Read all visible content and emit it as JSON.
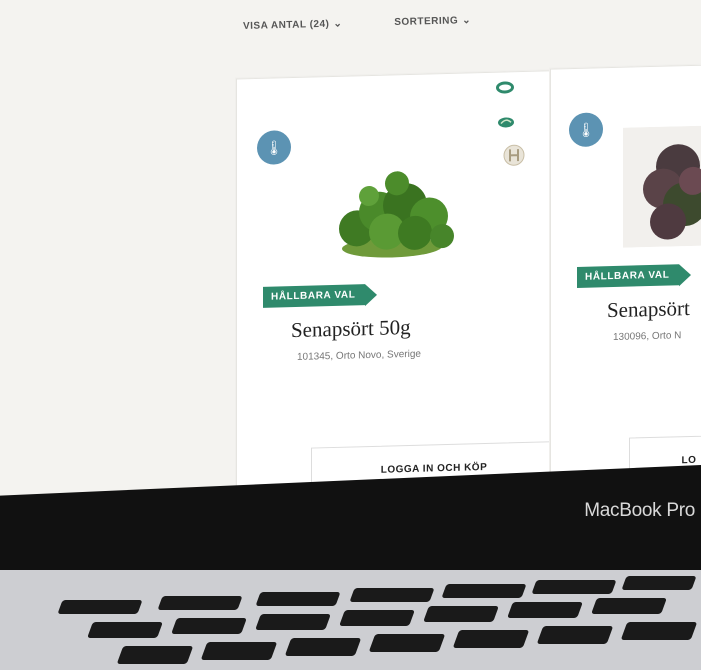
{
  "toolbar": {
    "show_count_label": "VISA ANTAL (24)",
    "sort_label": "SORTERING"
  },
  "products": [
    {
      "tag": "HÅLLBARA VAL",
      "name": "Senapsört 50g",
      "details": "101345, Orto Novo, Sverige",
      "button": "LOGGA IN OCH KÖP"
    },
    {
      "tag": "HÅLLBARA VAL",
      "name": "Senapsört",
      "details": "130096, Orto N",
      "button": "LO"
    }
  ],
  "laptop": {
    "brand_label": "MacBook Pro"
  },
  "colors": {
    "tag_green": "#2f8a6c",
    "icon_blue": "#5c93b3"
  }
}
